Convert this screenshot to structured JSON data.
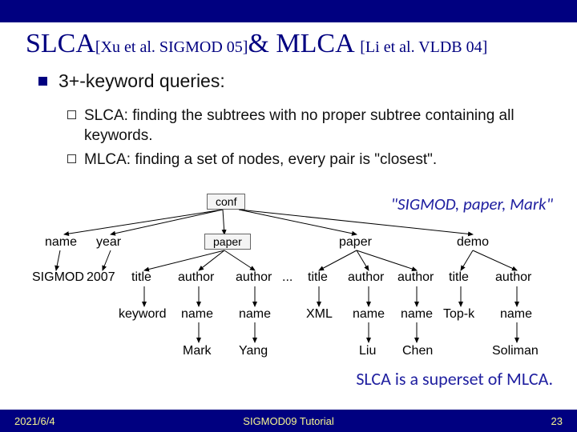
{
  "header": {
    "title_main1": "SLCA",
    "title_cite1": "[Xu et al. SIGMOD 05]",
    "title_amp": "& MLCA ",
    "title_cite2": "[Li et al. VLDB 04]"
  },
  "bullets": {
    "main": "3+-keyword queries:",
    "sub1": "SLCA: finding the subtrees with no proper subtree containing all keywords.",
    "sub2": "MLCA: finding a set of nodes, every pair is \"closest\"."
  },
  "quote": "\"SIGMOD, paper, Mark\"",
  "slca_note": "SLCA is a superset of MLCA.",
  "tree": {
    "conf": "conf",
    "name": "name",
    "year": "year",
    "paper1": "paper",
    "paper2": "paper",
    "demo": "demo",
    "sigmod": "SIGMOD",
    "y2007": "2007",
    "title1": "title",
    "author1": "author",
    "author2": "author",
    "ellipsis": "...",
    "title2": "title",
    "author3": "author",
    "author4": "author",
    "title3": "title",
    "author5": "author",
    "keyword": "keyword",
    "name1": "name",
    "name2": "name",
    "xml": "XML",
    "name3": "name",
    "name4": "name",
    "topk": "Top-k",
    "name5": "name",
    "mark": "Mark",
    "yang": "Yang",
    "liu": "Liu",
    "chen": "Chen",
    "soliman": "Soliman"
  },
  "footer": {
    "date": "2021/6/4",
    "center": "SIGMOD09 Tutorial",
    "page": "23"
  }
}
